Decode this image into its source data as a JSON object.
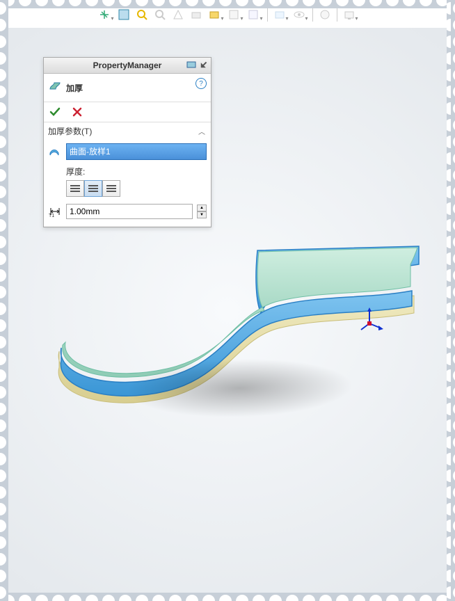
{
  "panel": {
    "title": "PropertyManager",
    "feature_name": "加厚",
    "section_title": "加厚参数(T)",
    "selected_surface": "曲面-放样1",
    "thickness_label": "厚度:",
    "thickness_value": "1.00mm",
    "direction_active_index": 1
  },
  "toolbar": {
    "icons": [
      "view-orientation-icon",
      "zoom-to-fit-icon",
      "zoom-to-area-icon",
      "previous-view-icon",
      "section-view-icon",
      "dynamic-view-icon",
      "display-style-icon",
      "hide-show-icon",
      "edit-appearance-icon",
      "apply-scene-icon",
      "view-settings-icon",
      "display-manager-icon",
      "screen-capture-icon"
    ]
  },
  "colors": {
    "selection": "#4a90d9",
    "edge": "#3aa0e0",
    "surface_top": "#b0e0d0",
    "surface_bottom": "#e8e0b0"
  }
}
